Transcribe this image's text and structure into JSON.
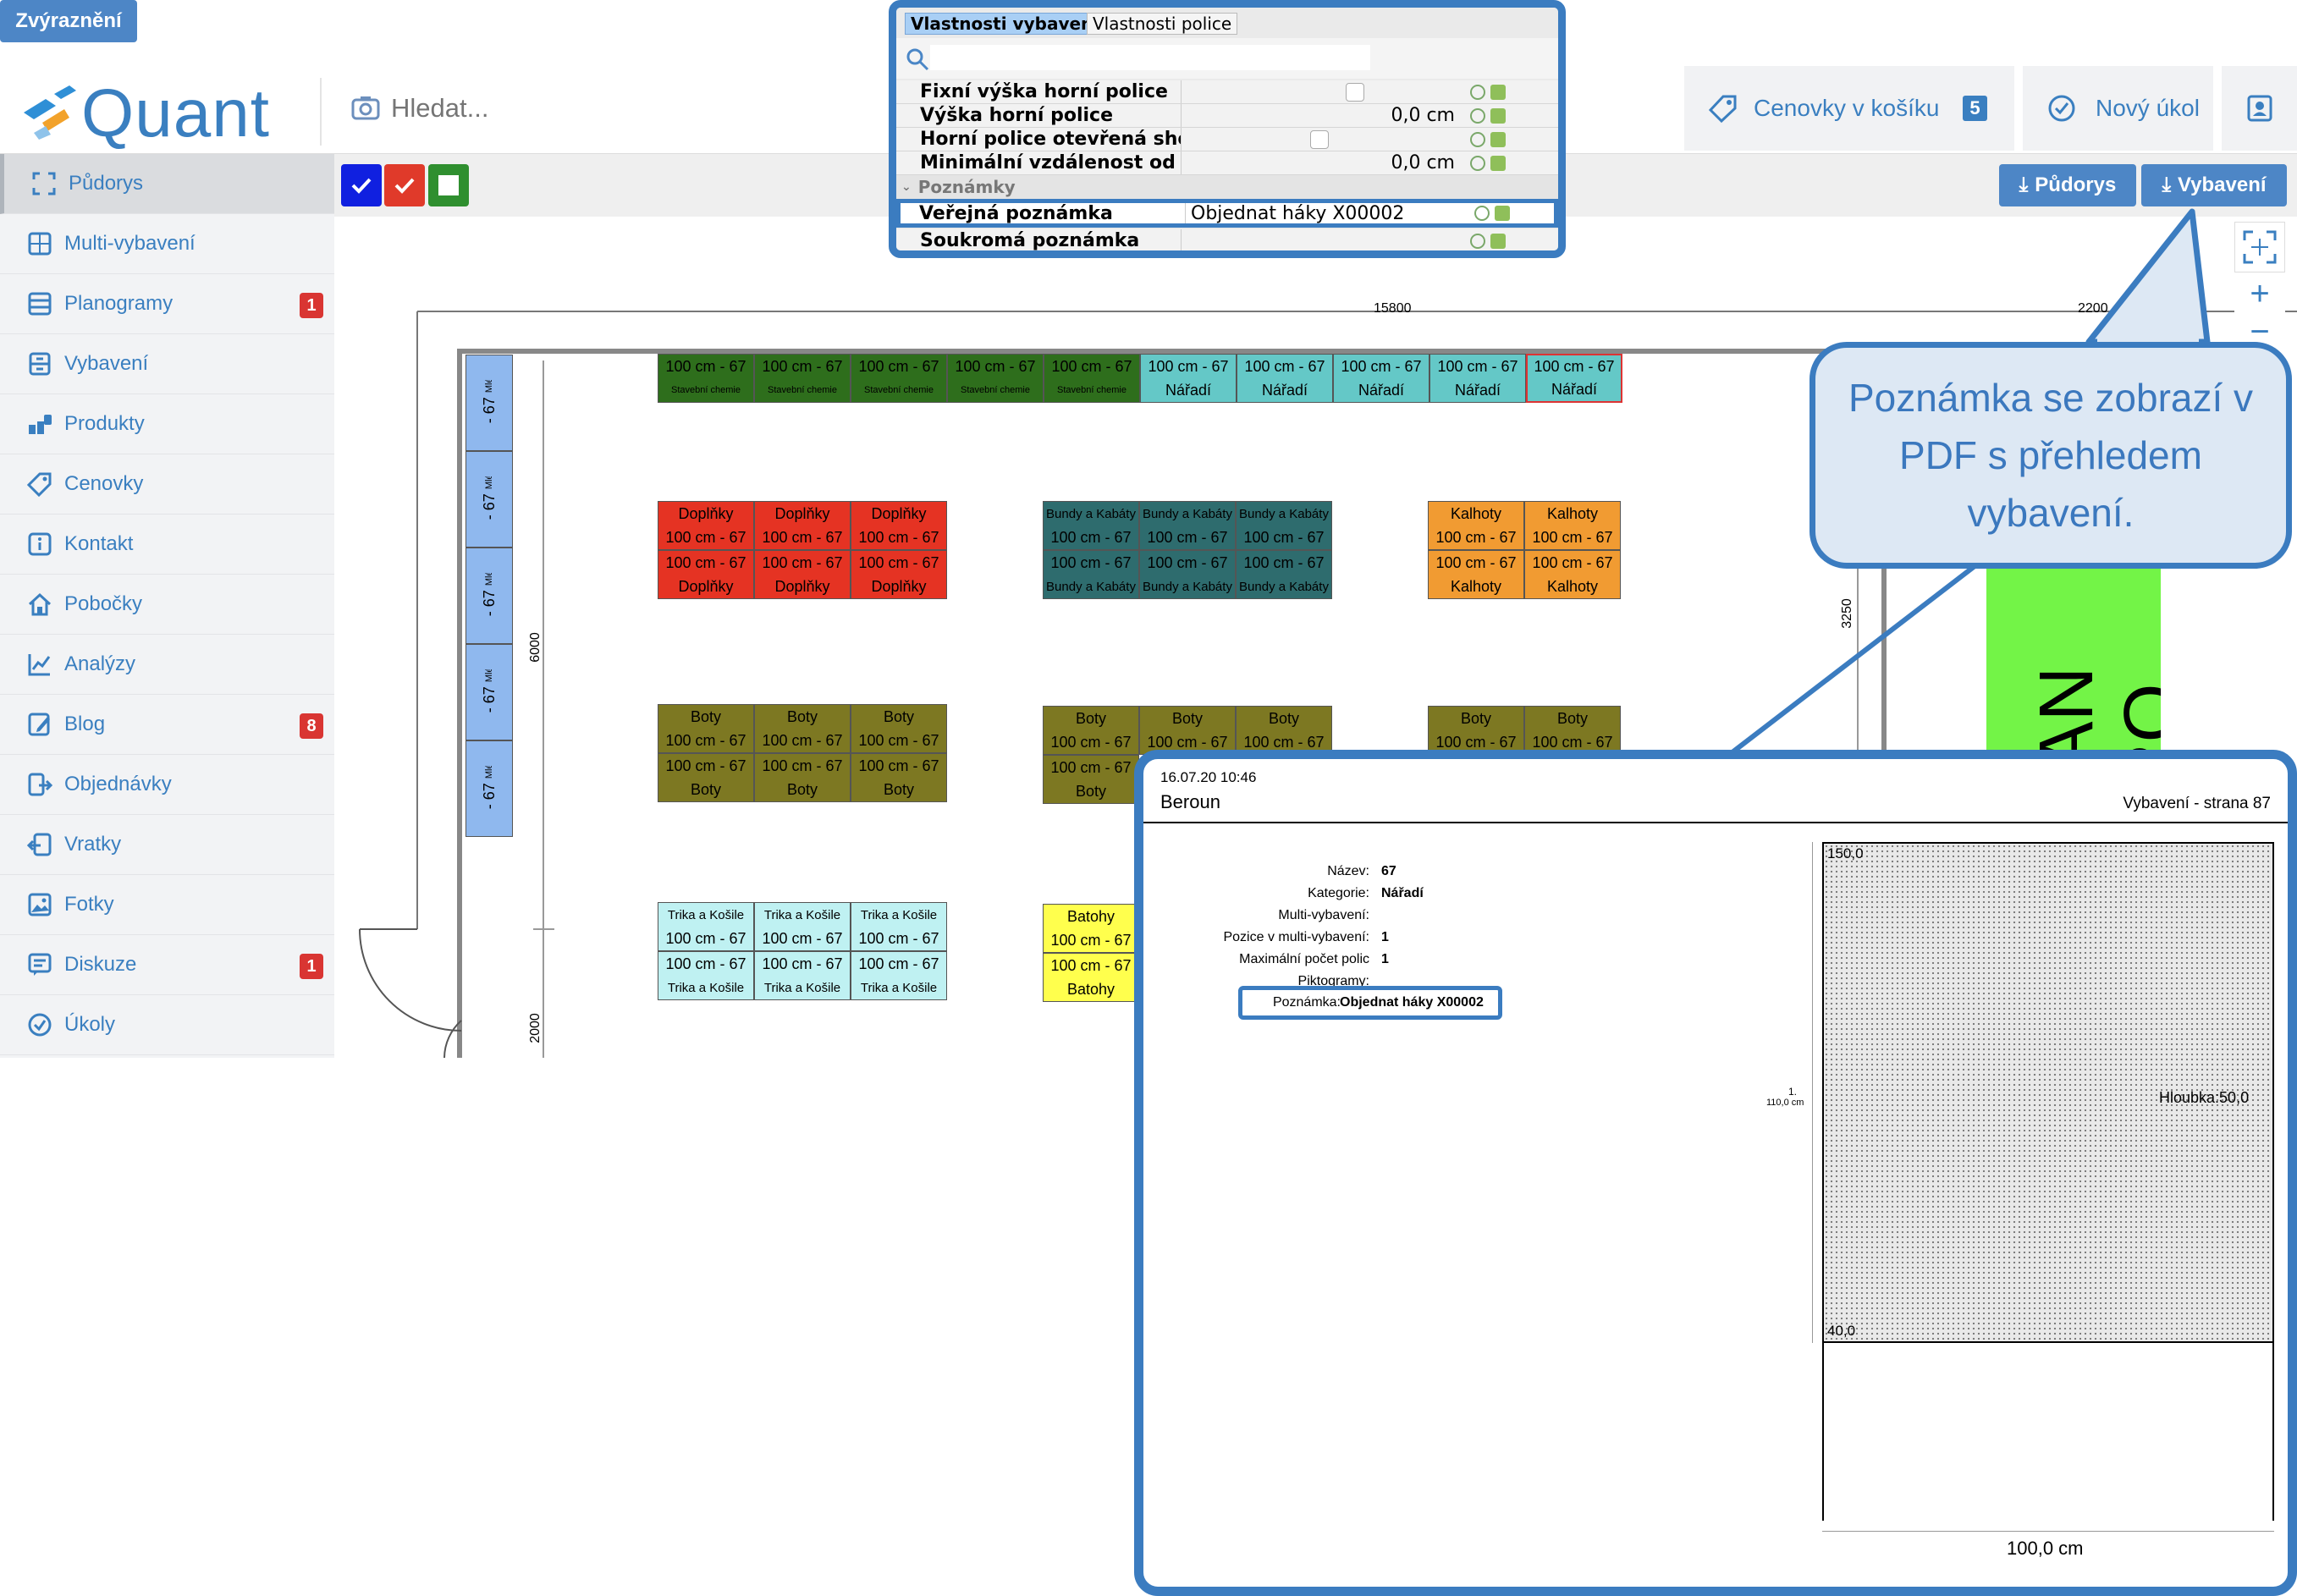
{
  "app": {
    "logo_text": "Quant"
  },
  "search": {
    "placeholder": "Hledat..."
  },
  "header": {
    "cart_label": "Cenovky v košíku",
    "cart_count": "5",
    "task_label": "Nový úkol"
  },
  "sidebar": {
    "items": [
      {
        "label": "Půdorys",
        "icon": "floorplan-icon",
        "active": true
      },
      {
        "label": "Multi-vybavení",
        "icon": "multi-equipment-icon"
      },
      {
        "label": "Planogramy",
        "icon": "planogram-icon",
        "badge": "1"
      },
      {
        "label": "Vybavení",
        "icon": "equipment-icon"
      },
      {
        "label": "Produkty",
        "icon": "products-icon"
      },
      {
        "label": "Cenovky",
        "icon": "price-tag-icon"
      },
      {
        "label": "Kontakt",
        "icon": "info-icon"
      },
      {
        "label": "Pobočky",
        "icon": "home-icon"
      },
      {
        "label": "Analýzy",
        "icon": "chart-icon"
      },
      {
        "label": "Blog",
        "icon": "blog-icon",
        "badge": "8"
      },
      {
        "label": "Objednávky",
        "icon": "orders-icon"
      },
      {
        "label": "Vratky",
        "icon": "returns-icon"
      },
      {
        "label": "Fotky",
        "icon": "photo-icon"
      },
      {
        "label": "Diskuze",
        "icon": "discussion-icon",
        "badge": "1"
      },
      {
        "label": "Úkoly",
        "icon": "tasks-icon"
      }
    ]
  },
  "toolbar": {
    "highlight_label": "Zvýraznění",
    "floorplan_download": "Půdorys",
    "equipment_download": "Vybavení",
    "colors": {
      "blue": "#1020e0",
      "red": "#e03a2a",
      "green": "#2f8f2f"
    }
  },
  "floorplan": {
    "dims": {
      "top": "15800",
      "top_right": "2200",
      "left": "6000",
      "left_bottom": "2000",
      "right": "3250"
    },
    "size_label": "100 cm - 67",
    "side_category": "Mléčné výrobky",
    "top_row": [
      "Stavební chemie",
      "Stavební chemie",
      "Stavební chemie",
      "Stavební chemie",
      "Stavební chemie",
      "Nářadí",
      "Nářadí",
      "Nářadí",
      "Nářadí",
      "Nářadí"
    ],
    "groups": {
      "doplnky": "Doplňky",
      "bundy": "Bundy a Kabáty",
      "kalhoty": "Kalhoty",
      "boty": "Boty",
      "trika": "Trika a Košile",
      "batohy": "Batohy"
    },
    "sign": {
      "line1": "CHAN",
      "line2": "RO"
    },
    "colors": {
      "stavebni": "#2e6e1c",
      "naradi": "#64c8c7",
      "mlecne": "#8fb8ee",
      "doplnky": "#e53323",
      "bundy": "#2e6c6e",
      "kalhoty": "#f19b32",
      "boty": "#7d7822",
      "trika": "#bff1f2",
      "batohy": "#ffff4d",
      "sign": "#73f447"
    }
  },
  "properties": {
    "tabs": [
      "Vlastnosti vybavení",
      "Vlastnosti police"
    ],
    "rows": [
      {
        "label": "Fixní výška horní police",
        "value": ""
      },
      {
        "label": "Výška horní police",
        "value": "0,0 cm"
      },
      {
        "label": "Horní police otevřená sho…",
        "value": ""
      },
      {
        "label": "Minimální vzdálenost od …",
        "value": "0,0 cm"
      }
    ],
    "section": "Poznámky",
    "public_note_label": "Veřejná poznámka",
    "public_note_value": "Objednat háky X00002",
    "private_note_label": "Soukromá poznámka"
  },
  "callout": {
    "text": "Poznámka se zobrazí v PDF s přehledem vybavení."
  },
  "pdf": {
    "timestamp": "16.07.20 10:46",
    "store": "Beroun",
    "page": "Vybavení - strana 87",
    "fields": [
      {
        "label": "Název:",
        "value": "67"
      },
      {
        "label": "Kategorie:",
        "value": "Nářadí"
      },
      {
        "label": "Multi-vybavení:",
        "value": ""
      },
      {
        "label": "Pozice v multi-vybavení:",
        "value": "1"
      },
      {
        "label": "Maximální počet polic",
        "value": "1"
      },
      {
        "label": "Piktogramy:",
        "value": ""
      }
    ],
    "note_label": "Poznámka:",
    "note_value": "Objednat háky X00002",
    "shelf_top": "150,0",
    "shelf_bottom": "40,0",
    "shelf_number": "1.",
    "shelf_height": "110,0 cm",
    "depth": "Hloubka:50,0",
    "width": "100,0 cm"
  }
}
